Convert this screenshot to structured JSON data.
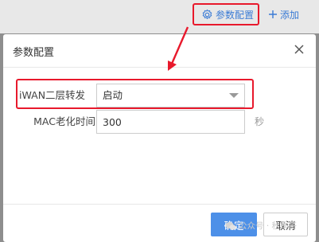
{
  "toolbar": {
    "config_label": "参数配置",
    "add_label": "添加",
    "config_icon": "gear-icon",
    "add_icon": "plus-icon"
  },
  "dialog": {
    "title": "参数配置",
    "close_icon": "close-icon",
    "fields": {
      "iwan": {
        "label": "iWAN二层转发",
        "value": "启动"
      },
      "mac_aging": {
        "label": "MAC老化时间",
        "value": "300",
        "unit": "秒"
      }
    },
    "buttons": {
      "ok": "确定",
      "cancel": "取消"
    }
  },
  "watermark": {
    "text": "公众号 · 秋季哥",
    "icon": "wechat-icon"
  },
  "colors": {
    "accent": "#3a7bd5",
    "primary_button": "#4d90e8",
    "annotation_red": "#e8192c",
    "overlay": "#8e8e8e"
  }
}
